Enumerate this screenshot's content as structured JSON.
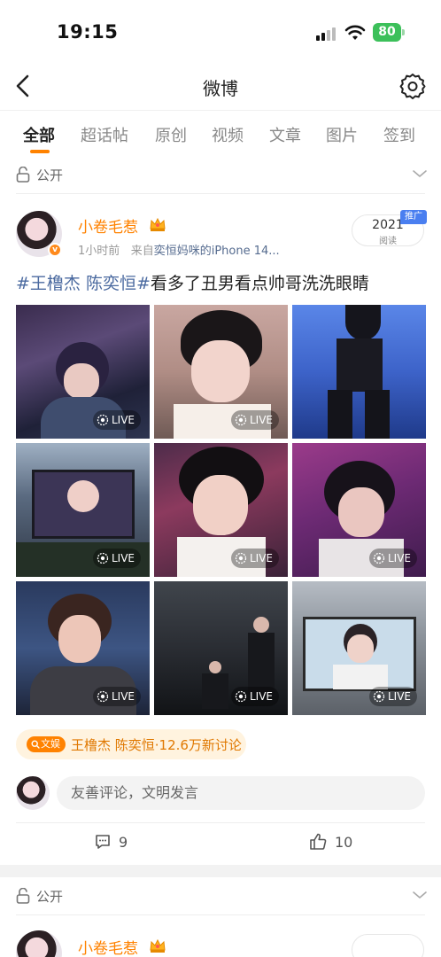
{
  "status_bar": {
    "time": "19:15",
    "battery": "80"
  },
  "nav": {
    "title": "微博"
  },
  "tabs": [
    {
      "label": "全部",
      "active": true
    },
    {
      "label": "超话帖",
      "active": false
    },
    {
      "label": "原创",
      "active": false
    },
    {
      "label": "视频",
      "active": false
    },
    {
      "label": "文章",
      "active": false
    },
    {
      "label": "图片",
      "active": false
    },
    {
      "label": "签到",
      "active": false
    }
  ],
  "privacy": {
    "label": "公开"
  },
  "post": {
    "username": "小卷毛惹",
    "time": "1小时前",
    "source_prefix": "来自",
    "source": "奕恒妈咪的iPhone 14...",
    "read_count": "2021",
    "read_label": "阅读",
    "promo_tag": "推广",
    "hashtag": "#王橹杰 陈奕恒#",
    "text": "看多了丑男看点帅哥洗洗眼睛",
    "live_label": "LIVE",
    "photo_count": 9,
    "topic": {
      "tag": "文娱",
      "label": "王橹杰 陈奕恒·12.6万新讨论"
    },
    "comment_placeholder": "友善评论，文明发言",
    "comments_count": "9",
    "likes_count": "10"
  },
  "next_post": {
    "privacy_label": "公开",
    "username": "小卷毛惹"
  },
  "colors": {
    "accent": "#ff8200",
    "hashtag": "#4b6aa0",
    "battery": "#3cc05a",
    "promo": "#4a7ff0"
  }
}
